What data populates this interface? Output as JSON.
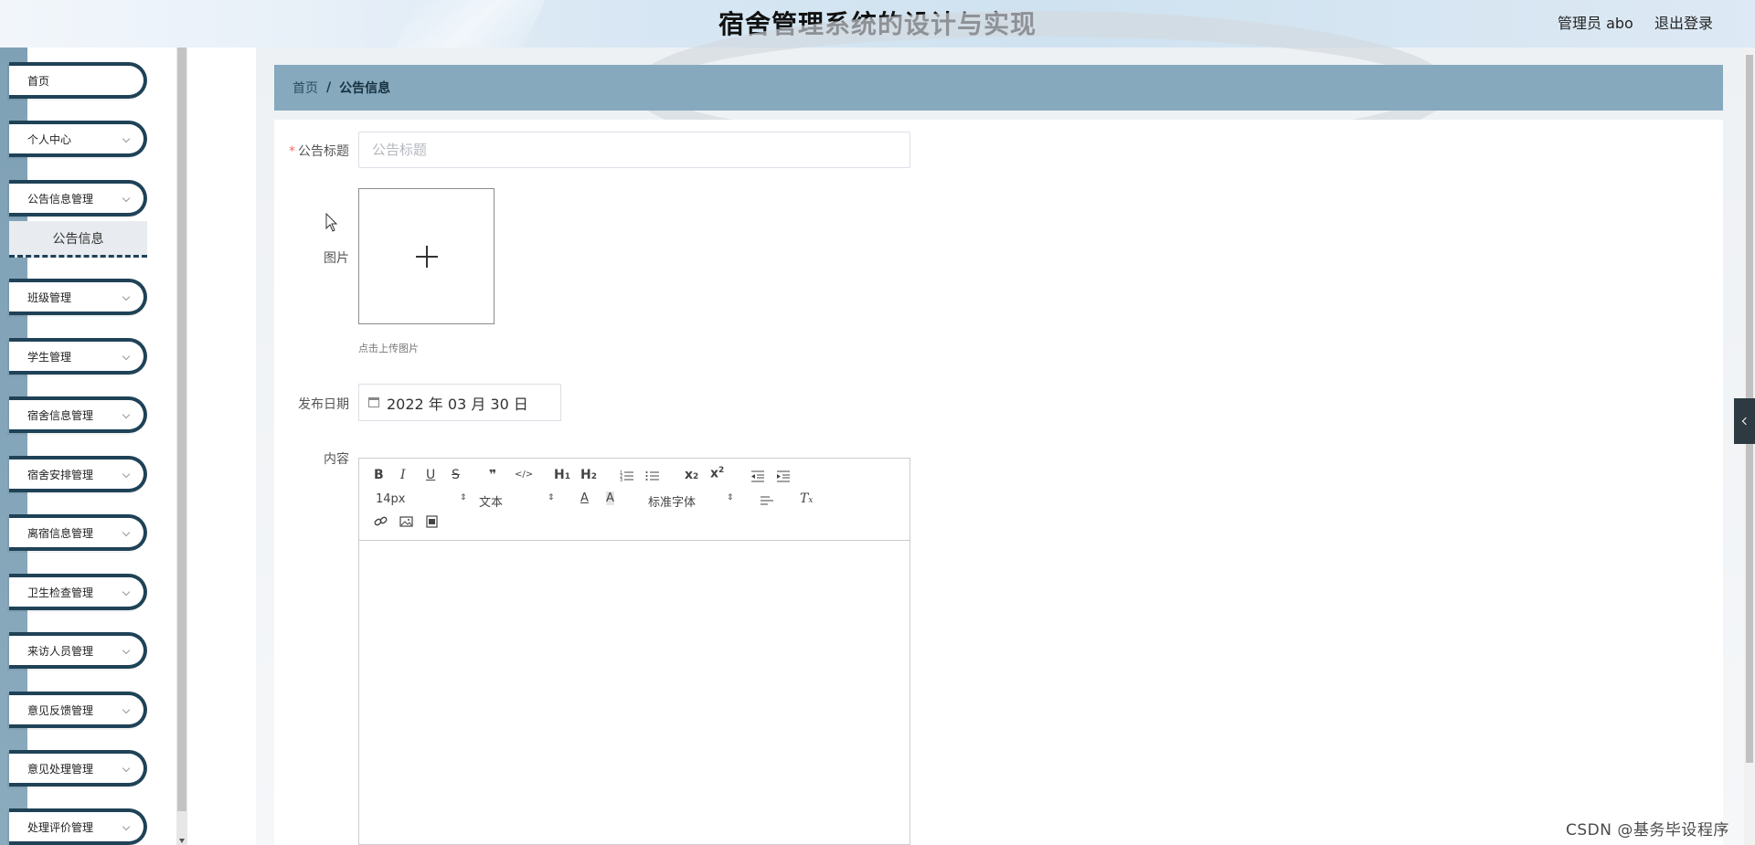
{
  "header": {
    "title": "宿舍管理系统的设计与实现",
    "user": "管理员 abo",
    "logout": "退出登录"
  },
  "sidebar": {
    "items": [
      {
        "label": "首页"
      },
      {
        "label": "个人中心"
      },
      {
        "label": "公告信息管理"
      },
      {
        "label": "班级管理"
      },
      {
        "label": "学生管理"
      },
      {
        "label": "宿舍信息管理"
      },
      {
        "label": "宿舍安排管理"
      },
      {
        "label": "离宿信息管理"
      },
      {
        "label": "卫生检查管理"
      },
      {
        "label": "来访人员管理"
      },
      {
        "label": "意见反馈管理"
      },
      {
        "label": "意见处理管理"
      },
      {
        "label": "处理评价管理"
      }
    ],
    "submenu_active": "公告信息"
  },
  "breadcrumb": {
    "home": "首页",
    "separator": "/",
    "current": "公告信息"
  },
  "form": {
    "title_label": "公告标题",
    "title_required_mark": "*",
    "title_placeholder": "公告标题",
    "image_label": "图片",
    "upload_tip": "点击上传图片",
    "date_label": "发布日期",
    "date_value": "2022 年 03 月 30 日",
    "content_label": "内容"
  },
  "editor": {
    "font_size": "14px",
    "header_select": "文本",
    "font_family": "标准字体",
    "buttons_row1": [
      "B",
      "I",
      "U",
      "S",
      "❞",
      "</>",
      "H1",
      "H2",
      "ordered-list",
      "bullet-list",
      "X2-sub",
      "X2-sup",
      "outdent",
      "indent"
    ],
    "buttons_row2": [
      "A",
      "A-bg",
      "align",
      "clear-format"
    ],
    "buttons_row3": [
      "link",
      "image",
      "video"
    ]
  },
  "watermark": "CSDN @基务毕设程序",
  "colors": {
    "accent_dark": "#1f4257",
    "breadcrumb_bg": "#86a9bd",
    "rail": "#8aaabd",
    "required": "#f56c6c"
  }
}
